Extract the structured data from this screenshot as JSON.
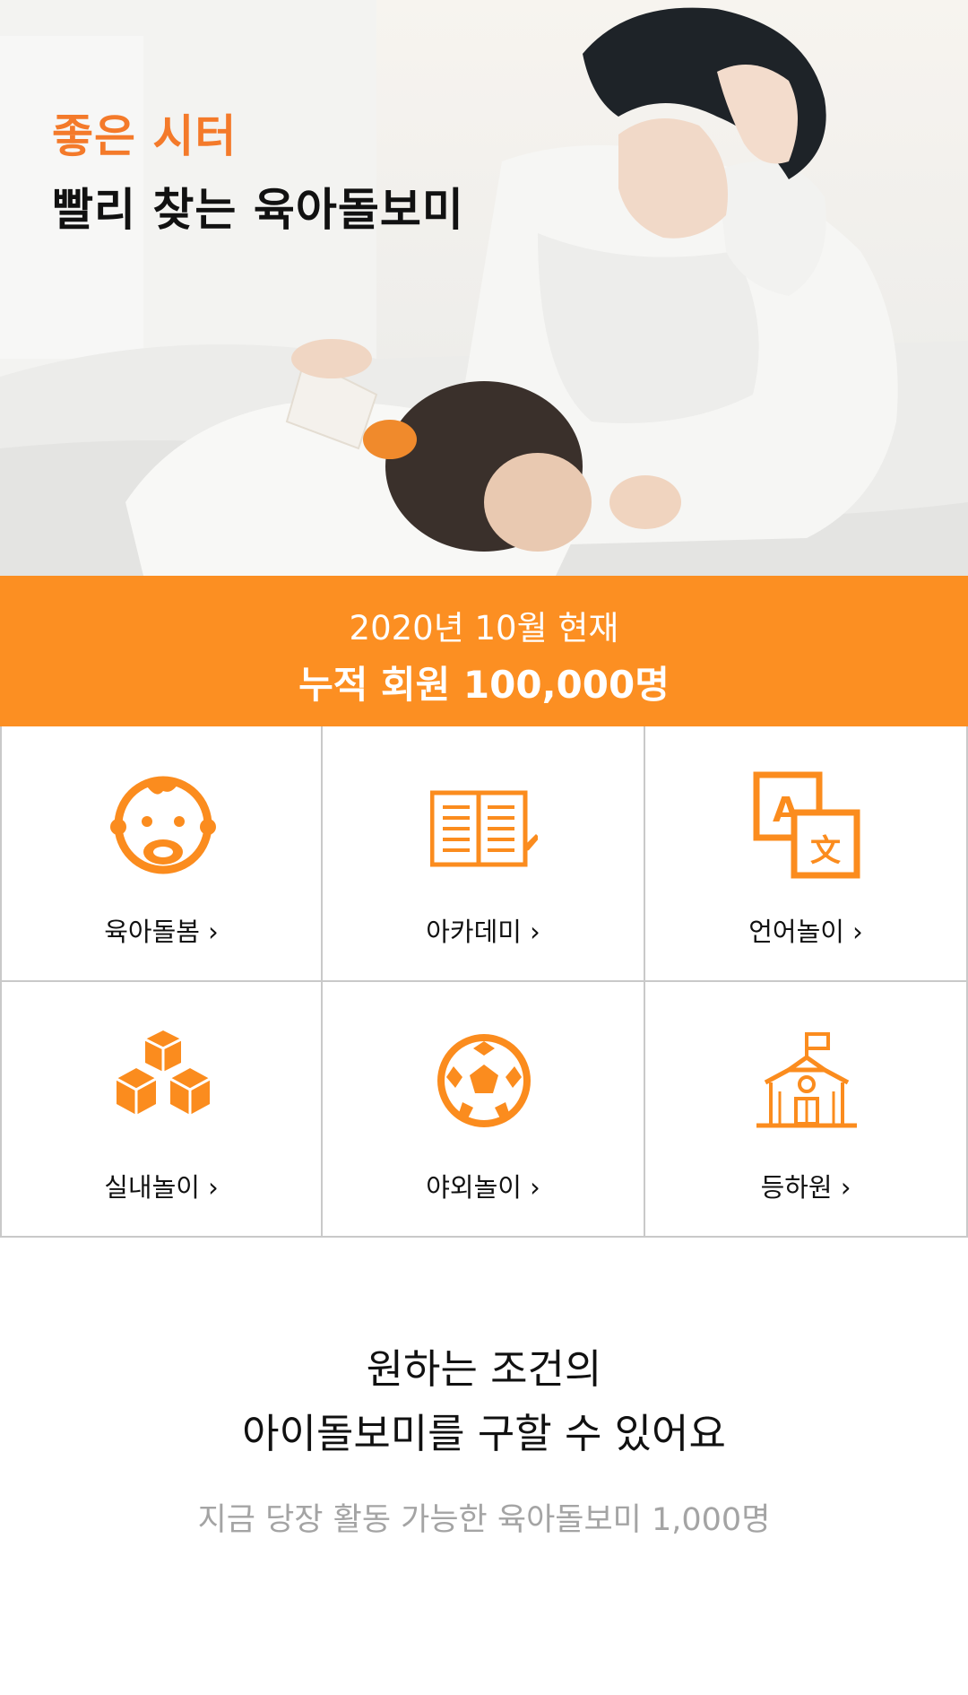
{
  "hero": {
    "title_line1": "좋은 시터",
    "title_line2": "빨리 찾는 육아돌보미",
    "accent_color": "#f47a2a"
  },
  "stats_band": {
    "line1": "2020년 10월 현재",
    "line2": "누적 회원 100,000명",
    "color": "#fc8f22"
  },
  "categories": [
    {
      "label": "육아돌봄 ›",
      "icon": "baby-face-icon"
    },
    {
      "label": "아카데미 ›",
      "icon": "open-book-pencil-icon"
    },
    {
      "label": "언어놀이 ›",
      "icon": "translate-language-icon"
    },
    {
      "label": "실내놀이 ›",
      "icon": "toy-blocks-icon"
    },
    {
      "label": "야외놀이 ›",
      "icon": "soccer-ball-icon"
    },
    {
      "label": "등하원 ›",
      "icon": "school-building-icon"
    }
  ],
  "promo": {
    "title_line1": "원하는 조건의",
    "title_line2": "아이돌보미를 구할 수 있어요",
    "subtitle": "지금 당장 활동 가능한 육아돌보미 1,000명"
  },
  "icon_color": "#fb8c1e"
}
